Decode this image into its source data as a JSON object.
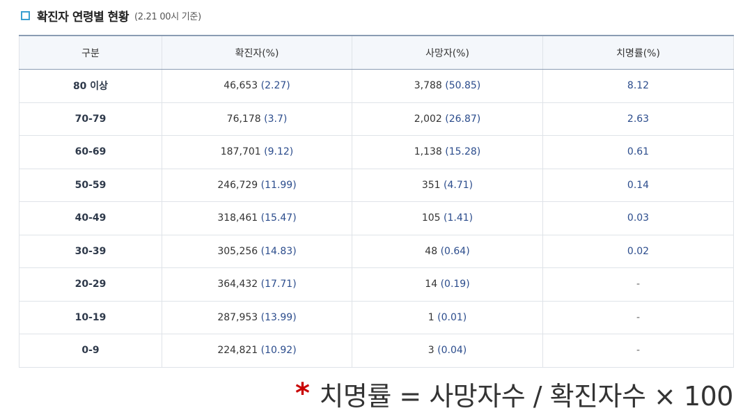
{
  "header": {
    "title": "확진자 연령별 현황",
    "subtitle": "(2.21 00시 기준)"
  },
  "table": {
    "columns": [
      "구분",
      "확진자(%)",
      "사망자(%)",
      "치명률(%)"
    ],
    "rows": [
      {
        "group": "80 이상",
        "confirmed": "46,653",
        "confirmed_pct": "(2.27)",
        "deaths": "3,788",
        "deaths_pct": "(50.85)",
        "fatality": "8.12"
      },
      {
        "group": "70-79",
        "confirmed": "76,178",
        "confirmed_pct": "(3.7)",
        "deaths": "2,002",
        "deaths_pct": "(26.87)",
        "fatality": "2.63"
      },
      {
        "group": "60-69",
        "confirmed": "187,701",
        "confirmed_pct": "(9.12)",
        "deaths": "1,138",
        "deaths_pct": "(15.28)",
        "fatality": "0.61"
      },
      {
        "group": "50-59",
        "confirmed": "246,729",
        "confirmed_pct": "(11.99)",
        "deaths": "351",
        "deaths_pct": "(4.71)",
        "fatality": "0.14"
      },
      {
        "group": "40-49",
        "confirmed": "318,461",
        "confirmed_pct": "(15.47)",
        "deaths": "105",
        "deaths_pct": "(1.41)",
        "fatality": "0.03"
      },
      {
        "group": "30-39",
        "confirmed": "305,256",
        "confirmed_pct": "(14.83)",
        "deaths": "48",
        "deaths_pct": "(0.64)",
        "fatality": "0.02"
      },
      {
        "group": "20-29",
        "confirmed": "364,432",
        "confirmed_pct": "(17.71)",
        "deaths": "14",
        "deaths_pct": "(0.19)",
        "fatality": "-"
      },
      {
        "group": "10-19",
        "confirmed": "287,953",
        "confirmed_pct": "(13.99)",
        "deaths": "1",
        "deaths_pct": "(0.01)",
        "fatality": "-"
      },
      {
        "group": "0-9",
        "confirmed": "224,821",
        "confirmed_pct": "(10.92)",
        "deaths": "3",
        "deaths_pct": "(0.04)",
        "fatality": "-"
      }
    ]
  },
  "footnote": {
    "star": "*",
    "formula": "치명률 = 사망자수 / 확진자수 × 100"
  },
  "colors": {
    "accent": "#3a9fd0",
    "value_blue": "#2b4c8c",
    "star_red": "#c90000"
  }
}
